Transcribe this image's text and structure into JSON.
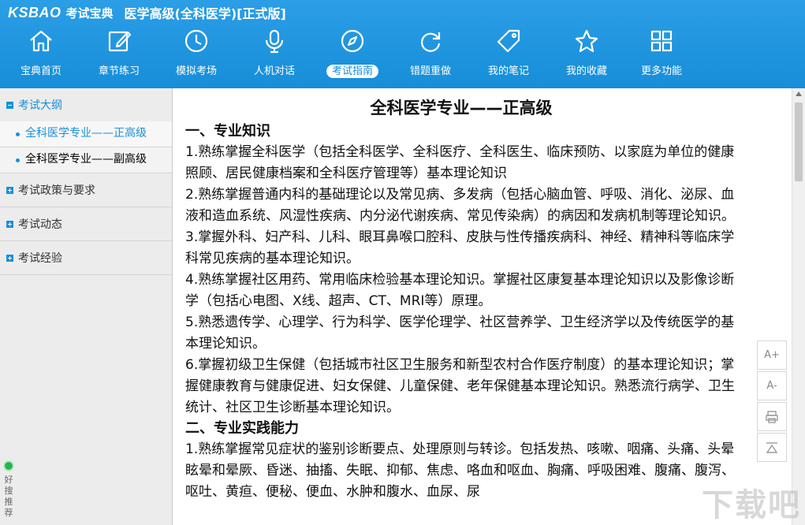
{
  "window": {
    "logo": "KSBAO",
    "logo_cn": "考试宝典",
    "title": "医学高级(全科医学)[正式版]"
  },
  "nav": [
    {
      "label": "宝典首页",
      "icon": "home-icon"
    },
    {
      "label": "章节练习",
      "icon": "edit-icon"
    },
    {
      "label": "模拟考场",
      "icon": "clock-icon"
    },
    {
      "label": "人机对话",
      "icon": "microphone-icon"
    },
    {
      "label": "考试指南",
      "icon": "compass-icon",
      "active": true
    },
    {
      "label": "错题重做",
      "icon": "refresh-icon"
    },
    {
      "label": "我的笔记",
      "icon": "tag-icon"
    },
    {
      "label": "我的收藏",
      "icon": "star-icon"
    },
    {
      "label": "更多功能",
      "icon": "grid-icon"
    }
  ],
  "sidebar": {
    "sections": [
      {
        "label": "考试大纲",
        "open": true,
        "items": [
          {
            "label": "全科医学专业——正高级",
            "selected": true
          },
          {
            "label": "全科医学专业——副高级",
            "selected": false
          }
        ]
      },
      {
        "label": "考试政策与要求",
        "open": false
      },
      {
        "label": "考试动态",
        "open": false
      },
      {
        "label": "考试经验",
        "open": false
      }
    ],
    "badge": "好搜推荐"
  },
  "article": {
    "title": "全科医学专业——正高级",
    "h1": "一、专业知识",
    "p1": "1.熟练掌握全科医学（包括全科医学、全科医疗、全科医生、临床预防、以家庭为单位的健康照顾、居民健康档案和全科医疗管理等）基本理论知识",
    "p2": "2.熟练掌握普通内科的基础理论以及常见病、多发病（包括心脑血管、呼吸、消化、泌尿、血液和造血系统、风湿性疾病、内分泌代谢疾病、常见传染病）的病因和发病机制等理论知识。",
    "p3": "3.掌握外科、妇产科、儿科、眼耳鼻喉口腔科、皮肤与性传播疾病科、神经、精神科等临床学科常见疾病的基本理论知识。",
    "p4": "4.熟练掌握社区用药、常用临床检验基本理论知识。掌握社区康复基本理论知识以及影像诊断学（包括心电图、X线、超声、CT、MRI等）原理。",
    "p5": "5.熟悉遗传学、心理学、行为科学、医学伦理学、社区营养学、卫生经济学以及传统医学的基本理论知识。",
    "p6": "6.掌握初级卫生保健（包括城市社区卫生服务和新型农村合作医疗制度）的基本理论知识；掌握健康教育与健康促进、妇女保健、儿童保健、老年保健基本理论知识。熟悉流行病学、卫生统计、社区卫生诊断基本理论知识。",
    "h2": "二、专业实践能力",
    "p7": "1.熟练掌握常见症状的鉴别诊断要点、处理原则与转诊。包括发热、咳嗽、咽痛、头痛、头晕眩晕和晕厥、昏迷、抽搐、失眠、抑郁、焦虑、咯血和呕血、胸痛、呼吸困难、腹痛、腹泻、呕吐、黄疸、便秘、便血、水肿和腹水、血尿、尿"
  },
  "tools": {
    "font_up": "A+",
    "font_down": "A-"
  },
  "watermark": "下载吧"
}
